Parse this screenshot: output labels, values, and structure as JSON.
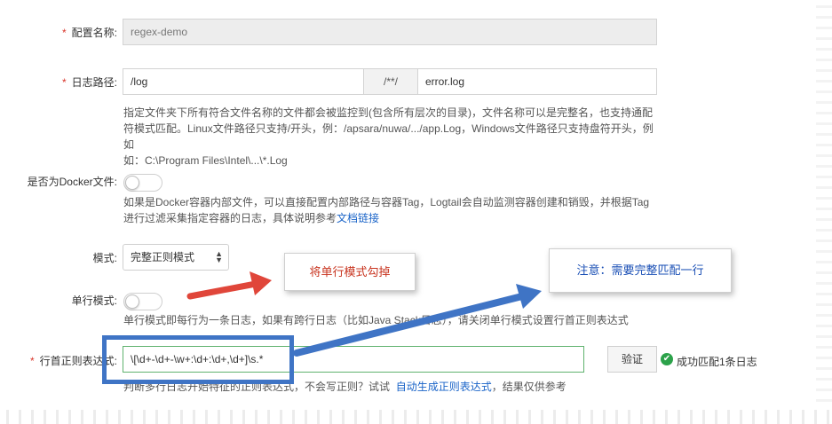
{
  "form": {
    "config_name": {
      "label": "配置名称:",
      "value": "regex-demo"
    },
    "log_path": {
      "label": "日志路径:",
      "dir_value": "/log",
      "separator": "/**/",
      "file_value": "error.log",
      "help_lines": [
        "指定文件夹下所有符合文件名称的文件都会被监控到(包含所有层次的目录)，文件名称可以是完整名，也支持通配",
        "符模式匹配。Linux文件路径只支持/开头，例：/apsara/nuwa/.../app.Log，Windows文件路径只支持盘符开头，例如",
        "如：C:\\Program Files\\Intel\\...\\*.Log"
      ]
    },
    "docker": {
      "label": "是否为Docker文件:",
      "help_line1": "如果是Docker容器内部文件，可以直接配置内部路径与容器Tag，Logtail会自动监测容器创建和销毁，并根据Tag",
      "help_line2_prefix": "进行过滤采集指定容器的日志，具体说明参考",
      "help_link": "文档链接"
    },
    "mode": {
      "label": "模式:",
      "value": "完整正则模式"
    },
    "single_line": {
      "label": "单行模式:",
      "help": "单行模式即每行为一条日志，如果有跨行日志（比如Java Stack日志），请关闭单行模式设置行首正则表达式"
    },
    "line_start_regex": {
      "label": "行首正则表达式:",
      "value": "\\[\\d+-\\d+-\\w+:\\d+:\\d+,\\d+]\\s.*",
      "verify_button": "验证",
      "result": "成功匹配1条日志",
      "help_prefix": "判断多行日志开始特征的正则表达式，不会写正则？试试",
      "help_link": "自动生成正则表达式",
      "help_suffix": "，结果仅供参考"
    }
  },
  "annotations": {
    "callout_left": "将单行模式勾掉",
    "callout_right": "注意：需要完整匹配一行"
  },
  "colors": {
    "required": "#d9362b",
    "link": "#1a64c8",
    "success": "#2ca24a",
    "arrow_red": "#e0463a",
    "arrow_blue": "#3f74c5",
    "callout_left_text": "#c8341f",
    "callout_right_text": "#1a4fb5"
  }
}
